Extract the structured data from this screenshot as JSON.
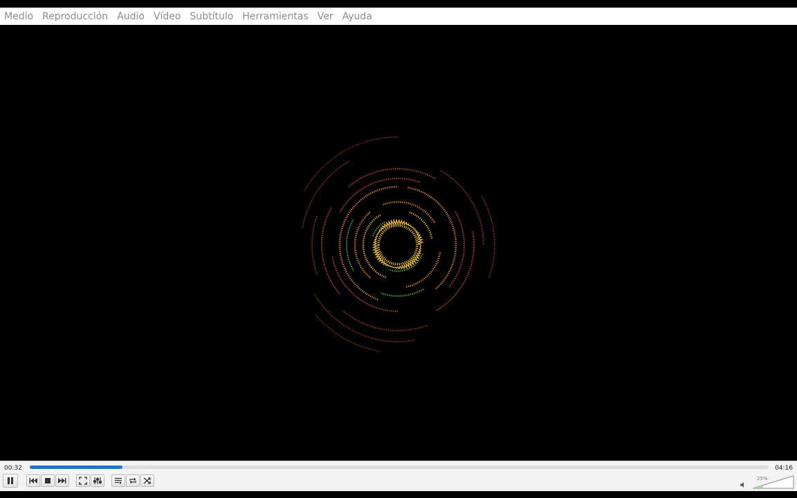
{
  "menu": {
    "items": [
      "Medio",
      "Reproducción",
      "Audio",
      "Vídeo",
      "Subtítulo",
      "Herramientas",
      "Ver",
      "Ayuda"
    ]
  },
  "playback": {
    "elapsed": "00:32",
    "total": "04:16",
    "progress_fraction": 0.125
  },
  "volume": {
    "label": "25%",
    "level_fraction": 0.25
  },
  "icons": {
    "pause": "pause-icon",
    "previous": "skip-previous-icon",
    "stop": "stop-icon",
    "next": "skip-next-icon",
    "fullscreen": "fullscreen-icon",
    "extended": "equalizer-icon",
    "playlist": "playlist-icon",
    "loop": "loop-icon",
    "shuffle": "shuffle-icon",
    "speaker": "speaker-icon"
  },
  "colors": {
    "accent": "#1f77c6",
    "visual_outer": "#d2512a",
    "visual_mid": "#e9902a",
    "visual_inner": "#f3c53a",
    "visual_green": "#7fc43a"
  }
}
